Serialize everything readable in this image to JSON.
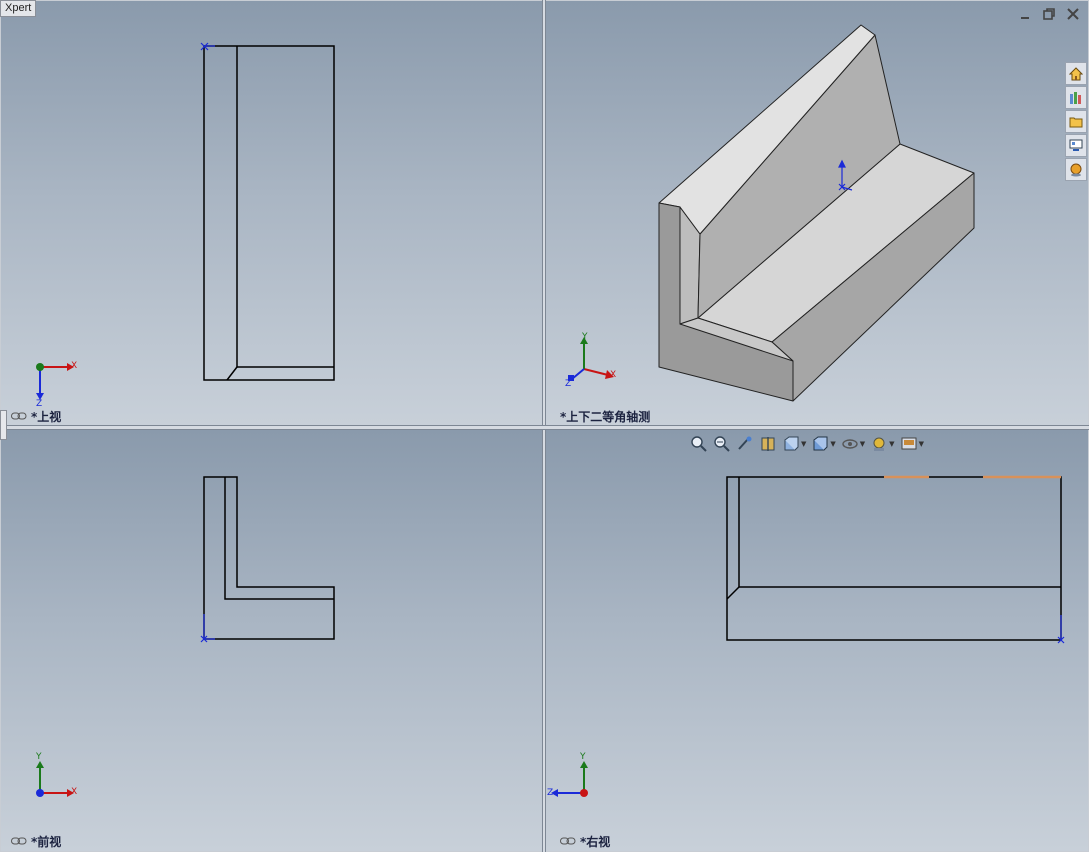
{
  "app": {
    "expert_tab_label": "Xpert"
  },
  "viewports": {
    "top": {
      "label": "*上视"
    },
    "iso": {
      "label": "*上下二等角轴测"
    },
    "front": {
      "label": "*前视"
    },
    "right": {
      "label": "*右视"
    }
  },
  "axes": {
    "x": "X",
    "y": "Y",
    "z": "Z"
  },
  "window_controls": [
    "minimize-icon",
    "restore-icon",
    "close-icon"
  ],
  "task_pane": [
    "home-icon",
    "design-library-icon",
    "file-explorer-icon",
    "view-palette-icon",
    "appearance-icon"
  ],
  "heads_up_toolbar": [
    "zoom-to-fit-icon",
    "zoom-to-area-icon",
    "previous-view-icon",
    "section-view-icon",
    "view-orientation-icon",
    "display-style-icon",
    "hide-show-items-icon",
    "edit-appearance-icon",
    "apply-scene-icon"
  ],
  "colors": {
    "sketch_line": "#000000",
    "origin": "#1a2ad8",
    "highlight_edge": "#d8915a",
    "model_top": "#d6d6d6",
    "model_front": "#9e9e9e",
    "model_side": "#b4b4b4"
  }
}
